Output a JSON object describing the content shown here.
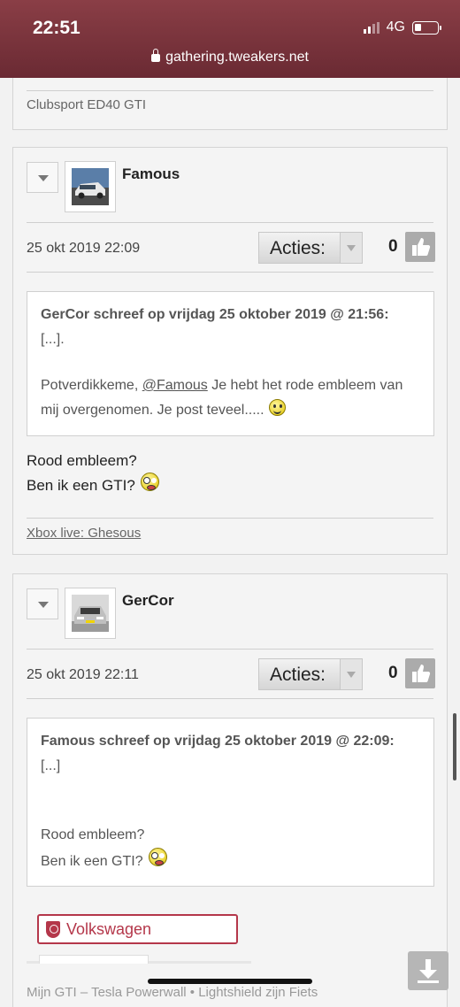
{
  "status_bar": {
    "time": "22:51",
    "network": "4G"
  },
  "browser": {
    "url": "gathering.tweakers.net"
  },
  "top_card": {
    "signature": "Clubsport ED40 GTI"
  },
  "posts": [
    {
      "username": "Famous",
      "date": "25 okt 2019 22:09",
      "actions_label": "Acties:",
      "score": "0",
      "quote": {
        "header": "GerCor schreef op vrijdag 25 oktober 2019 @ 21:56:",
        "ellipsis": "[...].",
        "text_before": "Potverdikkeme, ",
        "mention": "@Famous",
        "text_after_line1": " Je hebt het rode embleem van",
        "line2": "mij overgenomen. Je post teveel....."
      },
      "body_line1": "Rood embleem?",
      "body_line2": "Ben ik een GTI?",
      "signature": "Xbox live: Ghesous"
    },
    {
      "username": "GerCor",
      "date": "25 okt 2019 22:11",
      "actions_label": "Acties:",
      "score": "0",
      "quote": {
        "header": "Famous schreef op vrijdag 25 oktober 2019 @ 22:09:",
        "ellipsis": "[...]",
        "line1": "Rood embleem?",
        "line2": "Ben ik een GTI?"
      },
      "badge": "Volkswagen",
      "next_text": "Mijn GTI – Tesla Powerwall • Lightshield zijn Fiets"
    }
  ],
  "icons": {
    "toggle": "chevron-down-icon",
    "like": "thumbs-up-icon",
    "download": "download-icon",
    "lock": "lock-icon",
    "smiley": "smiley-icon",
    "dizzy": "dizzy-smiley-icon",
    "brand": "volkswagen-shield-icon"
  },
  "colors": {
    "header_bg": "#7a323b",
    "badge": "#b4374a"
  }
}
